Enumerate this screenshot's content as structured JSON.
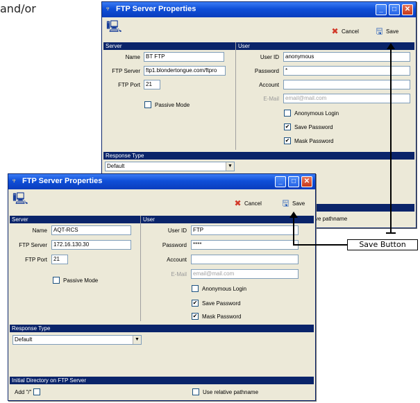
{
  "document": {
    "intro_fragment": "and/or"
  },
  "window_back": {
    "title": "FTP Server Properties",
    "toolbar": {
      "cancel_label": "Cancel",
      "save_label": "Save"
    },
    "server": {
      "section_label": "Server",
      "name_label": "Name",
      "name_value": "BT FTP",
      "ftp_server_label": "FTP Server",
      "ftp_server_value": "ftp1.blondertongue.com/ftpro",
      "ftp_port_label": "FTP Port",
      "ftp_port_value": "21",
      "passive_mode_label": "Passive Mode",
      "passive_mode_checked": false
    },
    "user": {
      "section_label": "User",
      "user_id_label": "User ID",
      "user_id_value": "anonymous",
      "password_label": "Password",
      "password_value": "*",
      "account_label": "Account",
      "account_value": "",
      "email_label": "E-Mail",
      "email_placeholder": "email@mail.com",
      "anonymous_login_label": "Anonymous Login",
      "anonymous_login_checked": false,
      "save_password_label": "Save Password",
      "save_password_checked": true,
      "mask_password_label": "Mask Password",
      "mask_password_checked": true
    },
    "response_type": {
      "section_label": "Response Type",
      "selected": "Default"
    },
    "partial_text": "ve pathname"
  },
  "window_front": {
    "title": "FTP Server Properties",
    "toolbar": {
      "cancel_label": "Cancel",
      "save_label": "Save"
    },
    "server": {
      "section_label": "Server",
      "name_label": "Name",
      "name_value": "AQT-RCS",
      "ftp_server_label": "FTP Server",
      "ftp_server_value": "172.16.130.30",
      "ftp_port_label": "FTP Port",
      "ftp_port_value": "21",
      "passive_mode_label": "Passive Mode",
      "passive_mode_checked": false
    },
    "user": {
      "section_label": "User",
      "user_id_label": "User ID",
      "user_id_value": "FTP",
      "password_label": "Password",
      "password_value": "****",
      "account_label": "Account",
      "account_value": "",
      "email_label": "E-Mail",
      "email_placeholder": "email@mail.com",
      "anonymous_login_label": "Anonymous Login",
      "anonymous_login_checked": false,
      "save_password_label": "Save Password",
      "save_password_checked": true,
      "mask_password_label": "Mask Password",
      "mask_password_checked": true
    },
    "response_type": {
      "section_label": "Response Type",
      "selected": "Default"
    },
    "initial_directory": {
      "section_label": "Initial Directory on FTP Server",
      "add_slash_label": "Add \"/\"",
      "add_slash_checked": false,
      "use_relative_label": "Use relative pathname",
      "use_relative_checked": false
    }
  },
  "callout": {
    "label": "Save Button"
  },
  "icons": {
    "check_glyph": "✔",
    "minimize_glyph": "_",
    "maximize_glyph": "□",
    "close_glyph": "✕",
    "dropdown_glyph": "▼"
  }
}
